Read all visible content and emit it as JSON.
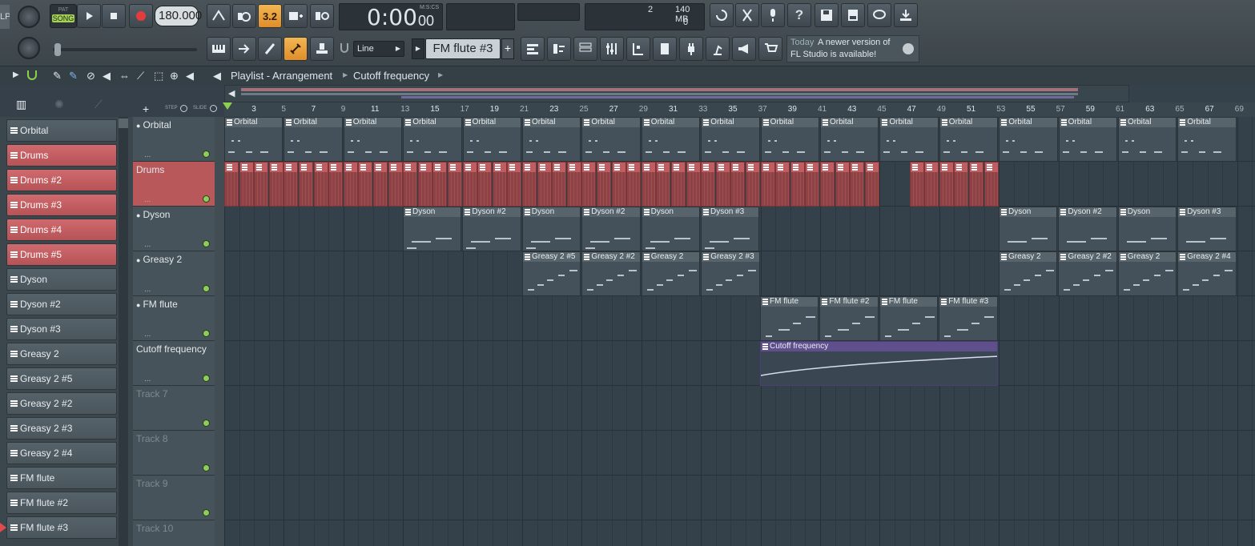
{
  "toolbar": {
    "pat_label": "PAT",
    "song_label": "SONG",
    "tempo": "180.000",
    "time_main": "0:00",
    "time_sub": "00",
    "time_format": "M:S:CS",
    "cpu_count": "2",
    "memory": "140 MB",
    "poly": "0",
    "snap_mode": "Line",
    "pattern_name": "FM flute #3",
    "news_when": "Today",
    "news_text_1": "A newer version of",
    "news_text_2": "FL Studio is available!",
    "left_stub": "LP"
  },
  "breadcrumb": {
    "part1": "Playlist - Arrangement",
    "part2": "Cutoff frequency"
  },
  "step_label": "STEP",
  "slide_label": "SLIDE",
  "ruler_numbers": [
    "3",
    "5",
    "7",
    "9",
    "11",
    "13",
    "15",
    "17",
    "19",
    "21",
    "23",
    "25",
    "27",
    "29",
    "31",
    "33",
    "35",
    "37",
    "39",
    "41",
    "43",
    "45",
    "47",
    "49",
    "51",
    "53",
    "55",
    "57",
    "59",
    "61",
    "63",
    "65",
    "67",
    "69"
  ],
  "channels": [
    {
      "label": "Orbital",
      "red": false
    },
    {
      "label": "Drums",
      "red": true
    },
    {
      "label": "Drums #2",
      "red": true
    },
    {
      "label": "Drums #3",
      "red": true
    },
    {
      "label": "Drums #4",
      "red": true
    },
    {
      "label": "Drums #5",
      "red": true
    },
    {
      "label": "Dyson",
      "red": false
    },
    {
      "label": "Dyson #2",
      "red": false
    },
    {
      "label": "Dyson #3",
      "red": false
    },
    {
      "label": "Greasy 2",
      "red": false
    },
    {
      "label": "Greasy 2 #5",
      "red": false
    },
    {
      "label": "Greasy 2 #2",
      "red": false
    },
    {
      "label": "Greasy 2 #3",
      "red": false
    },
    {
      "label": "Greasy 2 #4",
      "red": false
    },
    {
      "label": "FM flute",
      "red": false
    },
    {
      "label": "FM flute #2",
      "red": false
    },
    {
      "label": "FM flute #3",
      "red": false
    }
  ],
  "tracks": [
    {
      "name": "Orbital",
      "type": "normal"
    },
    {
      "name": "Drums",
      "type": "drums"
    },
    {
      "name": "Dyson",
      "type": "normal"
    },
    {
      "name": "Greasy 2",
      "type": "normal"
    },
    {
      "name": "FM flute",
      "type": "normal"
    },
    {
      "name": "Cutoff frequency",
      "type": "auto"
    },
    {
      "name": "Track 7",
      "type": "empty"
    },
    {
      "name": "Track 8",
      "type": "empty"
    },
    {
      "name": "Track 9",
      "type": "empty"
    },
    {
      "name": "Track 10",
      "type": "empty"
    }
  ],
  "clips": {
    "orbital": [
      "Orbital",
      "Orbital",
      "Orbital",
      "Orbital",
      "Orbital",
      "Orbital",
      "Orbital",
      "Orbital",
      "Orbital",
      "Orbital",
      "Orbital",
      "Orbital",
      "Orbital",
      "Orbital",
      "Orbital",
      "Orbital",
      "Orbital"
    ],
    "dyson_a": [
      "Dyson",
      "Dyson #2",
      "Dyson",
      "Dyson #2",
      "Dyson",
      "Dyson #3"
    ],
    "dyson_b": [
      "Dyson",
      "Dyson #2",
      "Dyson",
      "Dyson #3"
    ],
    "greasy_a": [
      "Greasy 2 #5",
      "Greasy 2 #2",
      "Greasy 2",
      "Greasy 2 #3"
    ],
    "greasy_b": [
      "Greasy 2",
      "Greasy 2 #2",
      "Greasy 2",
      "Greasy 2 #4"
    ],
    "flute": [
      "FM flute",
      "FM flute #2",
      "FM flute",
      "FM flute #3"
    ],
    "automation": "Cutoff frequency"
  },
  "colors": {
    "drums_clip": "#b9585b",
    "automation_clip": "#5f4f8c",
    "active_led": "#8bcf5a"
  }
}
